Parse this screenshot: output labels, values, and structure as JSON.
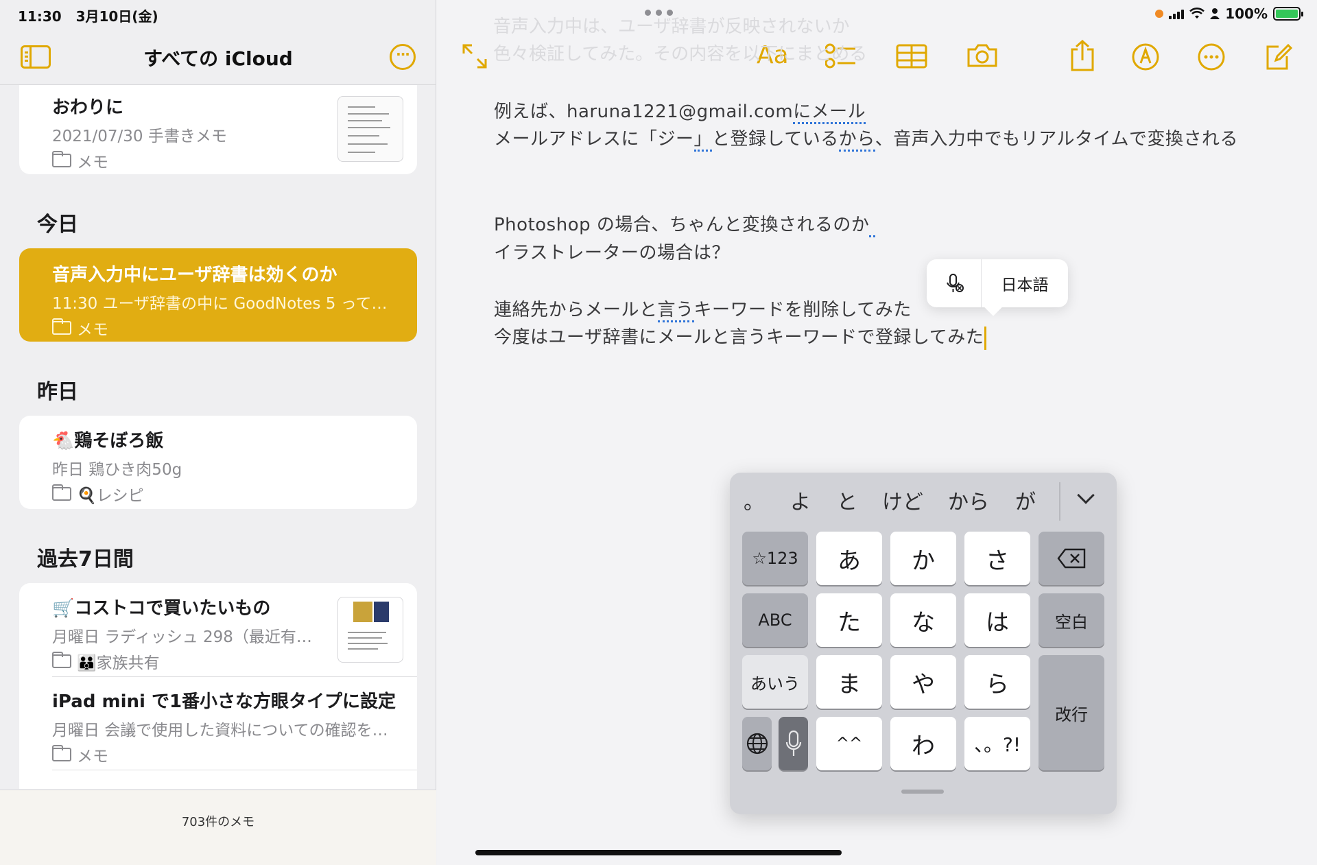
{
  "status": {
    "time": "11:30",
    "date": "3月10日(金)",
    "battery": "100%"
  },
  "sidebar": {
    "title": "すべての iCloud",
    "notes_count": "703件のメモ",
    "notes": [
      {
        "title": "おわりに",
        "meta": "2021/07/30  手書きメモ",
        "folder": "メモ"
      },
      {
        "title": "音声入力中にユーザ辞書は効くのか",
        "meta": "11:30  ユーザ辞書の中に GoodNotes 5 って…",
        "folder": "メモ"
      },
      {
        "title": "🐔鶏そぼろ飯",
        "meta": "昨日  鶏ひき肉50g",
        "folder": "🍳レシピ"
      },
      {
        "title": "🛒コストコで買いたいもの",
        "meta": "月曜日  ラディッシュ 298（最近有…",
        "folder": "👪家族共有"
      },
      {
        "title": "iPad mini で1番小さな方眼タイプに設定",
        "meta": "月曜日  会議で使用した資料についての確認を…",
        "folder": "メモ"
      }
    ],
    "sections": {
      "today": "今日",
      "yesterday": "昨日",
      "last7": "過去7日間"
    }
  },
  "toolbar": {
    "format_label": "Aa"
  },
  "note_body": {
    "ghost1": "音声入力中は、ユーザ辞書が反映されないか",
    "ghost2": "色々検証してみた。その内容を以下にまとめる",
    "line1a": "例えば、haruna1221@gmail.com",
    "line1b": "にメール",
    "line2a": "メールアドレスに「ジー",
    "line2b": "」",
    "line2c": "と登録している",
    "line2d": "から",
    "line2e": "、音声入力中でもリアルタイムで変換される",
    "line3a": "Photoshop の場合、ちゃんと変換されるのか",
    "line4": "イラストレーターの場合は？",
    "line5a": "連絡先からメールと",
    "line5b": "言う",
    "line5c": "キーワードを削除してみた",
    "line6": "今度はユーザ辞書にメールと言うキーワードで登録してみた"
  },
  "dictation_popup": {
    "language": "日本語"
  },
  "keyboard": {
    "candidates": [
      "。",
      "よ",
      "と",
      "けど",
      "から",
      "が"
    ],
    "keys": {
      "num": "☆123",
      "a": "あ",
      "ka": "か",
      "sa": "さ",
      "abc": "ABC",
      "ta": "た",
      "na": "な",
      "ha": "は",
      "space": "空白",
      "aiu": "あいう",
      "ma": "ま",
      "ya": "や",
      "ra": "ら",
      "enter": "改行",
      "kaomoji": "^^",
      "wa": "わ",
      "punct": "、。?!"
    }
  },
  "colors": {
    "accent": "#e0a800",
    "selected_note": "#e1ad12",
    "link_underline": "#2f74d8"
  }
}
